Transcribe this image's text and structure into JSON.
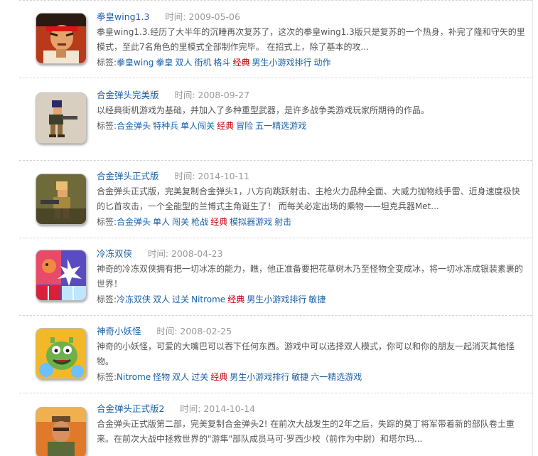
{
  "common": {
    "time_label": "时间:",
    "tags_label": "标签:"
  },
  "games": [
    {
      "title": "拳皇wing1.3",
      "time": "2009-05-06",
      "desc": "拳皇wing1.3.经历了大半年的沉睡再次复苏了，这次的拳皇wing1.3版只是复苏的一个热身，补完了隆和守矢的里模式，至此7名角色的里模式全部制作完毕。 在招式上，除了基本的攻...",
      "tags": [
        {
          "text": "拳皇wing",
          "hot": false
        },
        {
          "text": "拳皇",
          "hot": false
        },
        {
          "text": "双人",
          "hot": false
        },
        {
          "text": "街机",
          "hot": false
        },
        {
          "text": "格斗",
          "hot": false
        },
        {
          "text": "经典",
          "hot": true
        },
        {
          "text": "男生小游戏排行",
          "hot": false
        },
        {
          "text": "动作",
          "hot": false
        }
      ],
      "thumb_icon": "fighter-portrait-icon"
    },
    {
      "title": "合金弹头完美版",
      "time": "2008-09-27",
      "desc": "以经典街机游戏为基础，并加入了多种重型武器，是许多战争类游戏玩家所期待的作品。",
      "tags": [
        {
          "text": "合金弹头",
          "hot": false
        },
        {
          "text": "特种兵",
          "hot": false
        },
        {
          "text": "单人闯关",
          "hot": false
        },
        {
          "text": "经典",
          "hot": true
        },
        {
          "text": "冒险",
          "hot": false
        },
        {
          "text": "五一精选游戏",
          "hot": false
        }
      ],
      "thumb_icon": "pixel-soldier-icon"
    },
    {
      "title": "合金弹头正式版",
      "time": "2014-10-11",
      "desc": "合金弹头正式版，完美复制合金弹头1，八方向跳跃射击、主枪火力品种全面、大威力抛物线手雷、近身速度极快的匕首攻击，一个全能型的兰博式主角诞生了！ 而每关必定出场的乘物——坦克兵器Met...",
      "tags": [
        {
          "text": "合金弹头",
          "hot": false
        },
        {
          "text": "单人",
          "hot": false
        },
        {
          "text": "闯关",
          "hot": false
        },
        {
          "text": "枪战",
          "hot": false
        },
        {
          "text": "经典",
          "hot": true
        },
        {
          "text": "模拟器游戏",
          "hot": false
        },
        {
          "text": "射击",
          "hot": false
        }
      ],
      "thumb_icon": "pixel-gunner-icon"
    },
    {
      "title": "冷冻双侠",
      "time": "2008-04-23",
      "desc": "神奇的冷冻双侠拥有把一切冰冻的能力，瞧，他正准备要把花草树木乃至怪物全变成冰，将一切冰冻成银装素裹的世界！",
      "tags": [
        {
          "text": "冷冻双侠",
          "hot": false
        },
        {
          "text": "双人",
          "hot": false
        },
        {
          "text": "过关",
          "hot": false
        },
        {
          "text": "Nitrome",
          "hot": false
        },
        {
          "text": "经典",
          "hot": true
        },
        {
          "text": "男生小游戏排行",
          "hot": false
        },
        {
          "text": "敏捷",
          "hot": false
        }
      ],
      "thumb_icon": "ice-creature-icon"
    },
    {
      "title": "神奇小妖怪",
      "time": "2008-02-25",
      "desc": "神奇的小妖怪，可爱的大嘴巴可以吞下任何东西。游戏中可以选择双人模式，你可以和你的朋友一起消灭其他怪物。",
      "tags": [
        {
          "text": "Nitrome",
          "hot": false
        },
        {
          "text": "怪物",
          "hot": false
        },
        {
          "text": "双人",
          "hot": false
        },
        {
          "text": "过关",
          "hot": false
        },
        {
          "text": "经典",
          "hot": true
        },
        {
          "text": "男生小游戏排行",
          "hot": false
        },
        {
          "text": "敏捷",
          "hot": false
        },
        {
          "text": "六一精选游戏",
          "hot": false
        }
      ],
      "thumb_icon": "green-monster-icon"
    },
    {
      "title": "合金弹头正式版2",
      "time": "2014-10-14",
      "desc": "合金弹头正式版第二部，完美复制合金弹头2! 在前次大战发生的2年之后，失踪的莫丁将军带着新的部队卷土重来。在前次大战中拯救世界的\"游隼\"部队成员马可·罗西少校（前作为中尉）和塔尔玛...",
      "tags": [],
      "thumb_icon": "commando-portrait-icon"
    }
  ]
}
